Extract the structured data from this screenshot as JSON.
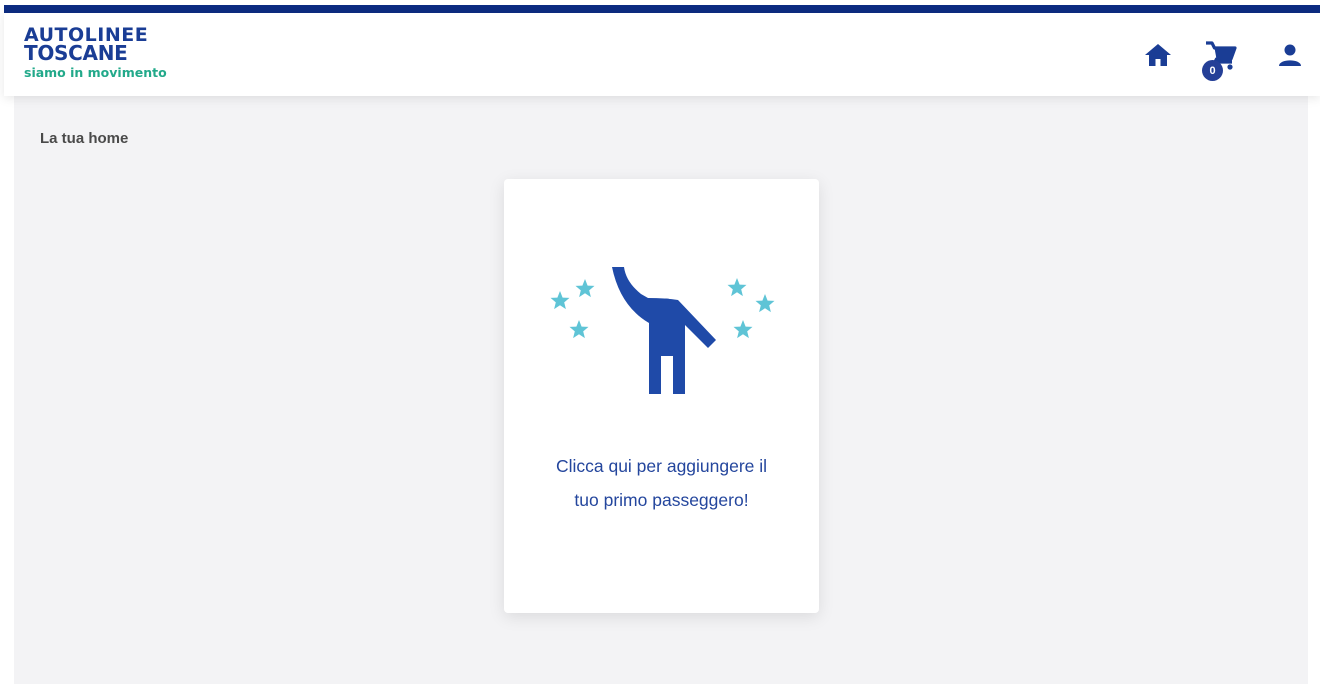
{
  "header": {
    "logo": {
      "line1": "AUTOLINEE",
      "line2": "TOSCANE",
      "tagline": "siamo in movimento"
    },
    "icons": [
      "home-icon",
      "cart-icon",
      "user-icon"
    ],
    "cart_count": "0"
  },
  "main": {
    "title": "La tua home",
    "card": {
      "text_line1": "Clicca qui per aggiungere il",
      "text_line2": "tuo primo passeggero!",
      "illustration": "person-waving-with-stars-icon"
    }
  },
  "colors": {
    "brand_dark_blue": "#0d2c82",
    "primary_blue": "#1a3d95",
    "accent_green": "#22a98a",
    "star_cyan": "#5fc4d6",
    "background": "#f3f3f5"
  }
}
